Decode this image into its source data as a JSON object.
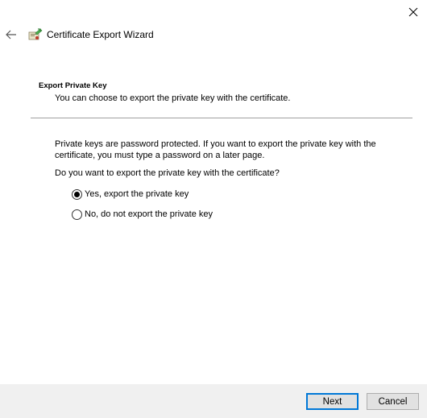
{
  "window": {
    "title": "Certificate Export Wizard"
  },
  "page": {
    "heading": "Export Private Key",
    "subheading": "You can choose to export the private key with the certificate.",
    "description": "Private keys are password protected. If you want to export the private key with the certificate, you must type a password on a later page.",
    "question": "Do you want to export the private key with the certificate?"
  },
  "options": [
    {
      "label": "Yes, export the private key",
      "selected": true
    },
    {
      "label": "No, do not export the private key",
      "selected": false
    }
  ],
  "buttons": {
    "next_label": "Next",
    "cancel_label": "Cancel"
  },
  "colors": {
    "accent": "#0078d7",
    "footer": "#f0f0f0",
    "divider": "#a0a0a0"
  },
  "icons": {
    "close": "close-icon",
    "back": "back-arrow-icon",
    "wizard": "certificate-icon"
  }
}
